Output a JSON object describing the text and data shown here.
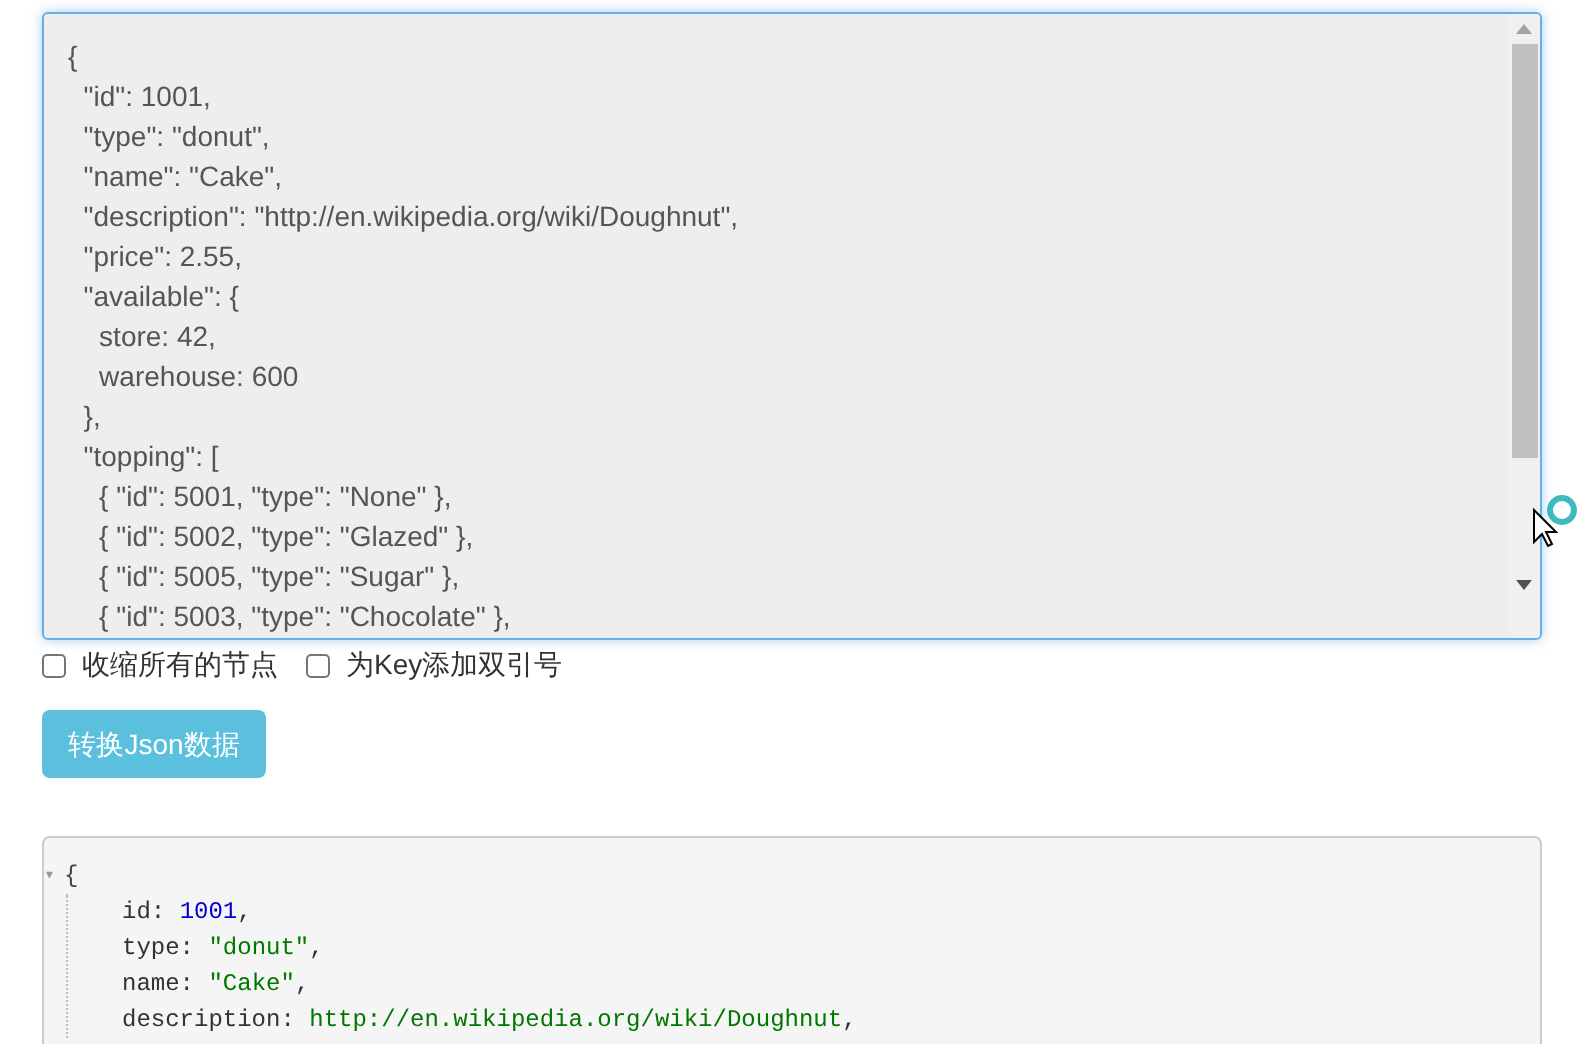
{
  "input_editor": {
    "lines": [
      "{",
      "  \"id\": 1001,",
      "  \"type\": \"donut\",",
      "  \"name\": \"Cake\",",
      "  \"description\": \"http://en.wikipedia.org/wiki/Doughnut\",",
      "  \"price\": 2.55,",
      "  \"available\": {",
      "    store: 42,",
      "    warehouse: 600",
      "  },",
      "  \"topping\": [",
      "    { \"id\": 5001, \"type\": \"None\" },",
      "    { \"id\": 5002, \"type\": \"Glazed\" },",
      "    { \"id\": 5005, \"type\": \"Sugar\" },",
      "    { \"id\": 5003, \"type\": \"Chocolate\" },"
    ]
  },
  "options": [
    {
      "label": "收缩所有的节点",
      "checked": false
    },
    {
      "label": "为Key添加双引号",
      "checked": false
    }
  ],
  "convert_button": "转换Json数据",
  "output": {
    "toggle": "▾",
    "open_brace": "{",
    "entries": [
      {
        "key": "id:",
        "value": "1001",
        "tail": ",",
        "kind": "number"
      },
      {
        "key": "type:",
        "value": "\"donut\"",
        "tail": ",",
        "kind": "string"
      },
      {
        "key": "name:",
        "value": "\"Cake\"",
        "tail": ",",
        "kind": "string"
      },
      {
        "key": "description:",
        "value": "http://en.wikipedia.org/wiki/Doughnut",
        "tail": ",",
        "kind": "link"
      }
    ]
  }
}
